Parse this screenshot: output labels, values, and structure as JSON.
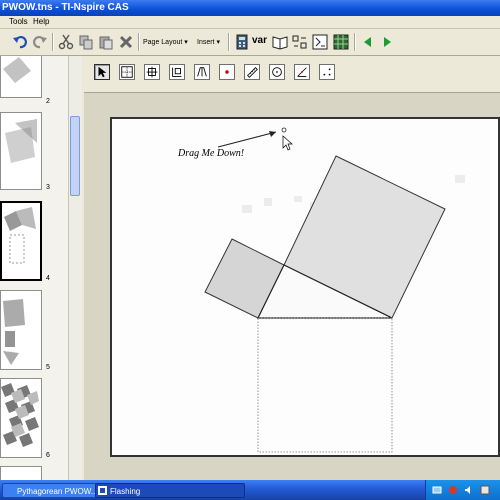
{
  "window": {
    "title": "PWOW.tns - TI-Nspire CAS"
  },
  "menu": {
    "items": [
      "Tools",
      "Help"
    ]
  },
  "toolbar": {
    "page_layout": "Page Layout",
    "insert": "Insert",
    "var": "var"
  },
  "pages": [
    {
      "number": "2"
    },
    {
      "number": "3"
    },
    {
      "number": "4"
    },
    {
      "number": "5"
    },
    {
      "number": "6"
    }
  ],
  "document": {
    "drag_label": "Drag Me Down!"
  },
  "taskbar": {
    "items": [
      "Pythagorean PWOW....",
      "Flashing"
    ]
  }
}
